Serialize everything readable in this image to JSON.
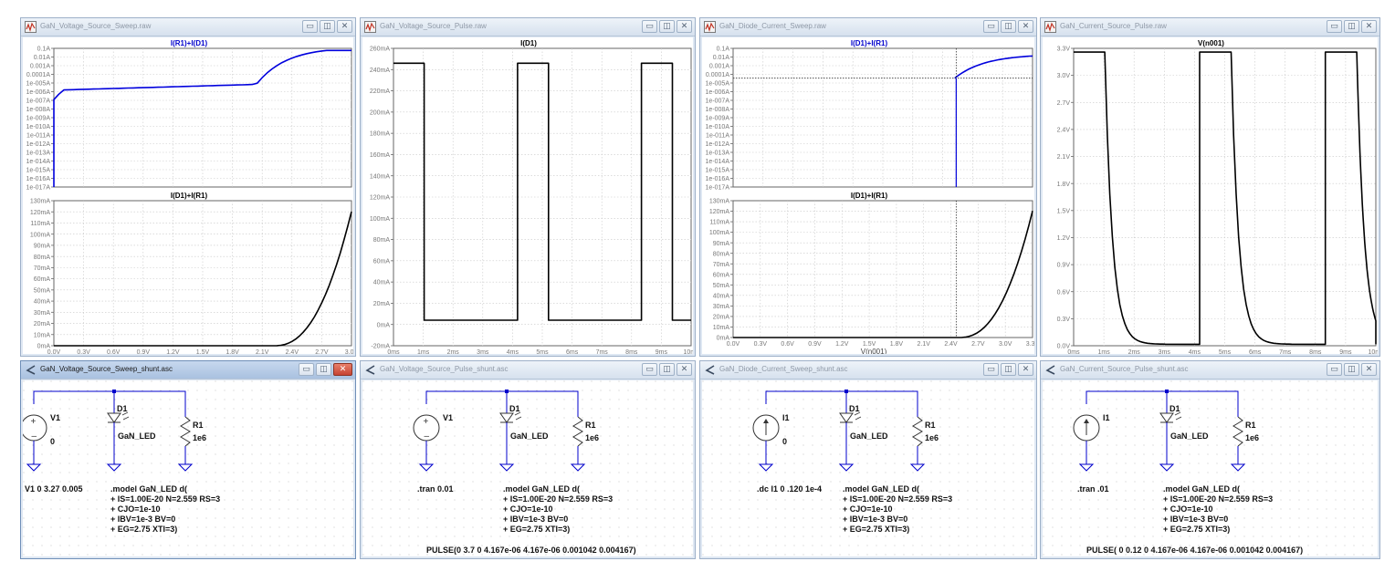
{
  "windows": [
    {
      "title": "GaN_Voltage_Source_Sweep.raw",
      "kind": "plot",
      "active": false,
      "panes": [
        {
          "title": "I(R1)+I(D1)",
          "title_color": "#0000cc",
          "x_labels": [],
          "y_labels": [
            "0.1A",
            "0.01A",
            "0.001A",
            "0.0001A",
            "1e-005A",
            "1e-006A",
            "1e-007A",
            "1e-008A",
            "1e-009A",
            "1e-010A",
            "1e-011A",
            "1e-012A",
            "1e-013A",
            "1e-014A",
            "1e-015A",
            "1e-016A",
            "1e-017A"
          ],
          "curve": "logsweep",
          "color": "#0000dd"
        },
        {
          "title": "I(D1)+I(R1)",
          "title_color": "#000000",
          "x_labels": [
            "0.0V",
            "0.3V",
            "0.6V",
            "0.9V",
            "1.2V",
            "1.5V",
            "1.8V",
            "2.1V",
            "2.4V",
            "2.7V",
            "3.0V"
          ],
          "y_labels": [
            "130mA",
            "120mA",
            "110mA",
            "100mA",
            "90mA",
            "80mA",
            "70mA",
            "60mA",
            "50mA",
            "40mA",
            "30mA",
            "20mA",
            "10mA",
            "0mA"
          ],
          "curve": "expo",
          "color": "#000000"
        }
      ]
    },
    {
      "title": "GaN_Voltage_Source_Pulse.raw",
      "kind": "plot",
      "active": false,
      "panes": [
        {
          "title": "I(D1)",
          "title_color": "#000000",
          "x_labels": [
            "0ms",
            "1ms",
            "2ms",
            "3ms",
            "4ms",
            "5ms",
            "6ms",
            "7ms",
            "8ms",
            "9ms",
            "10ms"
          ],
          "y_labels": [
            "260mA",
            "240mA",
            "220mA",
            "200mA",
            "180mA",
            "160mA",
            "140mA",
            "120mA",
            "100mA",
            "80mA",
            "60mA",
            "40mA",
            "20mA",
            "0mA",
            "-20mA"
          ],
          "curve": "pulse",
          "color": "#000000"
        }
      ]
    },
    {
      "title": "GaN_Diode_Current_Sweep.raw",
      "kind": "plot",
      "active": false,
      "panes": [
        {
          "title": "I(D1)+I(R1)",
          "title_color": "#0000cc",
          "x_labels": [],
          "y_labels": [
            "0.1A",
            "0.01A",
            "0.001A",
            "0.0001A",
            "1e-005A",
            "1e-006A",
            "1e-007A",
            "1e-008A",
            "1e-009A",
            "1e-010A",
            "1e-011A",
            "1e-012A",
            "1e-013A",
            "1e-014A",
            "1e-015A",
            "1e-016A",
            "1e-017A"
          ],
          "curve": "logcurrent",
          "color": "#0000dd"
        },
        {
          "title": "I(D1)+I(R1)",
          "title_color": "#000000",
          "x_labels": [
            "0.0V",
            "0.3V",
            "0.6V",
            "0.9V",
            "1.2V",
            "1.5V",
            "1.8V",
            "2.1V",
            "2.4V",
            "2.7V",
            "3.0V",
            "3.3V"
          ],
          "x_axis_title": "V(n001)",
          "y_labels": [
            "130mA",
            "120mA",
            "110mA",
            "100mA",
            "90mA",
            "80mA",
            "70mA",
            "60mA",
            "50mA",
            "40mA",
            "30mA",
            "20mA",
            "10mA",
            "0mA"
          ],
          "curve": "expo2",
          "color": "#000000"
        }
      ]
    },
    {
      "title": "GaN_Current_Source_Pulse.raw",
      "kind": "plot",
      "active": false,
      "panes": [
        {
          "title": "V(n001)",
          "title_color": "#000000",
          "x_labels": [
            "0ms",
            "1ms",
            "2ms",
            "3ms",
            "4ms",
            "5ms",
            "6ms",
            "7ms",
            "8ms",
            "9ms",
            "10ms"
          ],
          "y_labels": [
            "3.3V",
            "3.0V",
            "2.7V",
            "2.4V",
            "2.1V",
            "1.8V",
            "1.5V",
            "1.2V",
            "0.9V",
            "0.6V",
            "0.3V",
            "0.0V"
          ],
          "curve": "decay",
          "color": "#000000"
        }
      ]
    },
    {
      "title": "GaN_Voltage_Source_Sweep_shunt.asc",
      "kind": "schem",
      "active": true,
      "source": {
        "type": "V",
        "label": "V1",
        "value": "0"
      },
      "diode": {
        "label": "D1",
        "model": "GaN_LED"
      },
      "resistor": {
        "label": "R1",
        "value": "1e6"
      },
      "directive": "V1 0 3.27 0.005",
      "model_lines": [
        ".model GaN_LED d(",
        "+ IS=1.00E-20 N=2.559 RS=3",
        "+ CJO=1e-10",
        "+ IBV=1e-3 BV=0",
        "+ EG=2.75 XTI=3)"
      ],
      "extra": ""
    },
    {
      "title": "GaN_Voltage_Source_Pulse_shunt.asc",
      "kind": "schem",
      "active": false,
      "source": {
        "type": "V",
        "label": "V1",
        "value": ""
      },
      "diode": {
        "label": "D1",
        "model": "GaN_LED"
      },
      "resistor": {
        "label": "R1",
        "value": "1e6"
      },
      "directive": ".tran 0.01",
      "model_lines": [
        ".model GaN_LED d(",
        "+ IS=1.00E-20 N=2.559 RS=3",
        "+ CJO=1e-10",
        "+ IBV=1e-3 BV=0",
        "+ EG=2.75 XTI=3)"
      ],
      "extra": "PULSE(0 3.7 0 4.167e-06 4.167e-06 0.001042 0.004167)"
    },
    {
      "title": "GaN_Diode_Current_Sweep_shunt.asc",
      "kind": "schem",
      "active": false,
      "source": {
        "type": "I",
        "label": "I1",
        "value": "0"
      },
      "diode": {
        "label": "D1",
        "model": "GaN_LED"
      },
      "resistor": {
        "label": "R1",
        "value": "1e6"
      },
      "directive": ".dc I1 0 .120 1e-4",
      "model_lines": [
        ".model GaN_LED d(",
        "+ IS=1.00E-20 N=2.559 RS=3",
        "+ CJO=1e-10",
        "+ IBV=1e-3 BV=0",
        "+ EG=2.75 XTI=3)"
      ],
      "extra": ""
    },
    {
      "title": "GaN_Current_Source_Pulse_shunt.asc",
      "kind": "schem",
      "active": false,
      "source": {
        "type": "I",
        "label": "I1",
        "value": ""
      },
      "diode": {
        "label": "D1",
        "model": "GaN_LED"
      },
      "resistor": {
        "label": "R1",
        "value": "1e6"
      },
      "directive": ".tran .01",
      "model_lines": [
        ".model GaN_LED d(",
        "+ IS=1.00E-20 N=2.559 RS=3",
        "+ CJO=1e-10",
        "+ IBV=1e-3 BV=0",
        "+ EG=2.75 XTI=3)"
      ],
      "extra": "PULSE( 0 0.12 0 4.167e-06 4.167e-06 0.001042 0.004167)"
    }
  ],
  "window_controls": {
    "minimize": "▭",
    "restore": "◫",
    "close": "✕"
  },
  "chart_data": [
    {
      "type": "line",
      "title": "I(R1)+I(D1)",
      "y_scale": "log",
      "ylim": [
        "1e-017A",
        "0.1A"
      ],
      "series": [
        {
          "x": [
            0.0,
            0.01,
            0.1,
            0.5,
            1.0,
            1.5,
            2.0,
            2.2,
            2.4,
            2.6,
            2.8,
            3.0,
            3.27
          ],
          "y": [
            1e-17,
            1e-08,
            2e-07,
            4e-07,
            5e-07,
            6e-07,
            1e-06,
            1.5e-06,
            0.0001,
            0.002,
            0.015,
            0.045,
            0.12
          ]
        }
      ]
    },
    {
      "type": "line",
      "title": "I(D1)+I(R1)",
      "xlabel": "",
      "ylim": [
        0,
        130
      ],
      "series": [
        {
          "x": [
            0.0,
            2.4,
            2.6,
            2.7,
            2.8,
            2.9,
            3.0,
            3.1,
            3.2,
            3.27
          ],
          "y": [
            0,
            0,
            1,
            3,
            10,
            22,
            42,
            68,
            100,
            120
          ]
        }
      ]
    },
    {
      "type": "line",
      "title": "I(D1)",
      "ylim": [
        -20,
        260
      ],
      "series": [
        {
          "x": [
            0,
            1.04,
            4.17,
            5.21,
            8.33,
            9.38,
            10
          ],
          "y": [
            248,
            0,
            248,
            0,
            248,
            0,
            0
          ]
        }
      ]
    },
    {
      "type": "line",
      "title": "I(D1)+I(R1)",
      "y_scale": "log",
      "ylim": [
        "1e-017A",
        "0.1A"
      ],
      "series": [
        {
          "x": [
            2.45,
            2.6,
            2.8,
            3.0,
            3.2,
            3.3
          ],
          "y": [
            0.0001,
            0.008,
            0.03,
            0.06,
            0.1,
            0.12
          ]
        }
      ]
    },
    {
      "type": "line",
      "title": "I(D1)+I(R1)",
      "xlabel": "V(n001)",
      "ylim": [
        0,
        130
      ],
      "series": [
        {
          "x": [
            0.0,
            2.45,
            2.6,
            2.7,
            2.8,
            2.9,
            3.0,
            3.1,
            3.2,
            3.27
          ],
          "y": [
            0,
            0,
            1,
            3,
            10,
            22,
            42,
            68,
            100,
            120
          ]
        }
      ]
    },
    {
      "type": "line",
      "title": "V(n001)",
      "ylim": [
        0,
        3.3
      ],
      "series": [
        {
          "x": [
            0,
            1.04,
            1.1,
            1.3,
            1.6,
            2.0,
            4.17,
            5.21,
            5.27,
            5.5,
            6.2,
            8.33,
            9.38,
            9.5,
            9.9
          ],
          "y": [
            3.27,
            3.27,
            2.2,
            0.9,
            0.2,
            0.0,
            0.0,
            3.27,
            2.2,
            0.8,
            0.0,
            0.0,
            3.27,
            2.0,
            0.05
          ]
        }
      ]
    }
  ]
}
